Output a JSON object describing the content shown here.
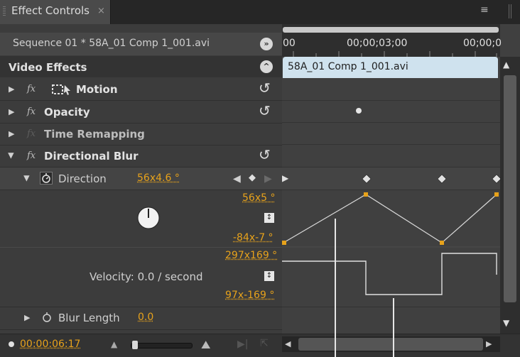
{
  "panel": {
    "tab_title": "Effect Controls",
    "tab_close": "×",
    "menu_icon": "≡"
  },
  "sequence": {
    "name": "Sequence 01 * 58A_01 Comp 1_001.avi"
  },
  "timeline": {
    "ruler_left": "00",
    "ruler_mid": "00;00;03;00",
    "ruler_right": "00;00;0",
    "clip_name": "58A_01 Comp 1_001.avi"
  },
  "video_effects": {
    "header": "Video Effects",
    "effects": [
      {
        "label": "Motion"
      },
      {
        "label": "Opacity"
      },
      {
        "label": "Time Remapping"
      },
      {
        "label": "Directional Blur"
      }
    ]
  },
  "direction": {
    "label": "Direction",
    "value": "56x4.6 °",
    "max_value": "56x5 °",
    "min_value": "-84x-7 °",
    "vel_max": "297x169 °",
    "vel_min": "97x-169 °",
    "velocity_label": "Velocity: 0.0 / second"
  },
  "blur_length": {
    "label": "Blur Length",
    "value": "0.0"
  },
  "footer": {
    "timecode": "00:00:06:17"
  },
  "colors": {
    "accent": "#e7a21b",
    "clip_bar": "#cfe2ee",
    "panel_bg": "#3c3c3c"
  }
}
